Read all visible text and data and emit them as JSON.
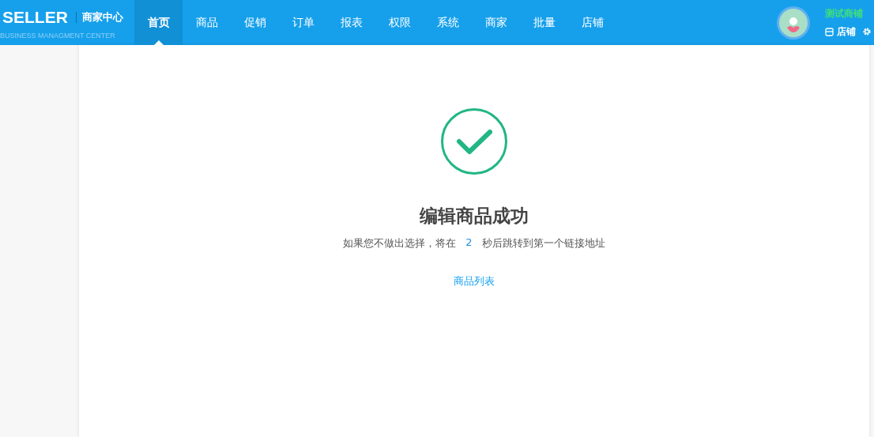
{
  "logo": {
    "brand": "SELLER",
    "title": "商家中心",
    "subtitle": "BUSINESS MANAGMENT CENTER"
  },
  "nav": [
    {
      "label": "首页",
      "selected": true
    },
    {
      "label": "商品",
      "selected": false
    },
    {
      "label": "促销",
      "selected": false
    },
    {
      "label": "订单",
      "selected": false
    },
    {
      "label": "报表",
      "selected": false
    },
    {
      "label": "权限",
      "selected": false
    },
    {
      "label": "系统",
      "selected": false
    },
    {
      "label": "商家",
      "selected": false
    },
    {
      "label": "批量",
      "selected": false
    },
    {
      "label": "店铺",
      "selected": false
    }
  ],
  "user": {
    "shop_name": "测试商铺",
    "shop_link": "店铺"
  },
  "result": {
    "title": "编辑商品成功",
    "message_before": "如果您不做出选择，将在",
    "countdown": "2",
    "message_after": "秒后跳转到第一个链接地址",
    "links": [
      "商品列表"
    ]
  }
}
